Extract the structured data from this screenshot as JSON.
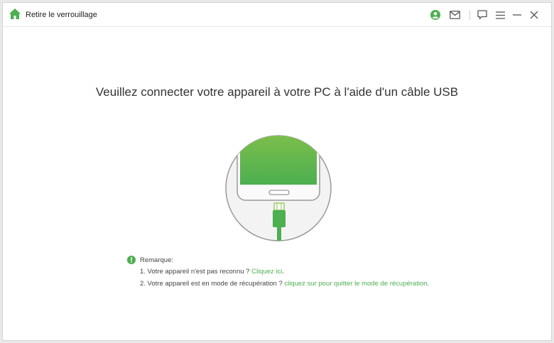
{
  "app": {
    "title": "Retire le verrouillage"
  },
  "main": {
    "headline": "Veuillez connecter votre appareil à votre PC à l'aide d'un câble USB"
  },
  "notes": {
    "heading": "Remarque:",
    "items": [
      {
        "text": "1. Votre appareil n'est pas reconnu ? ",
        "link": "Cliquez ici",
        "suffix": "."
      },
      {
        "text": "2. Votre appareil est en mode de récupération ? ",
        "link": "cliquez sur pour quitter le mode de récupération",
        "suffix": "."
      }
    ]
  },
  "icons": {
    "logo": "home-icon",
    "account": "account-icon",
    "mail": "mail-icon",
    "feedback": "feedback-icon",
    "menu": "menu-icon",
    "minimize": "minimize-icon",
    "close": "close-icon",
    "notice": "exclamation-icon"
  },
  "colors": {
    "accent": "#4caf50",
    "screen_top": "#8bc34a",
    "screen_bottom": "#4caf50"
  }
}
